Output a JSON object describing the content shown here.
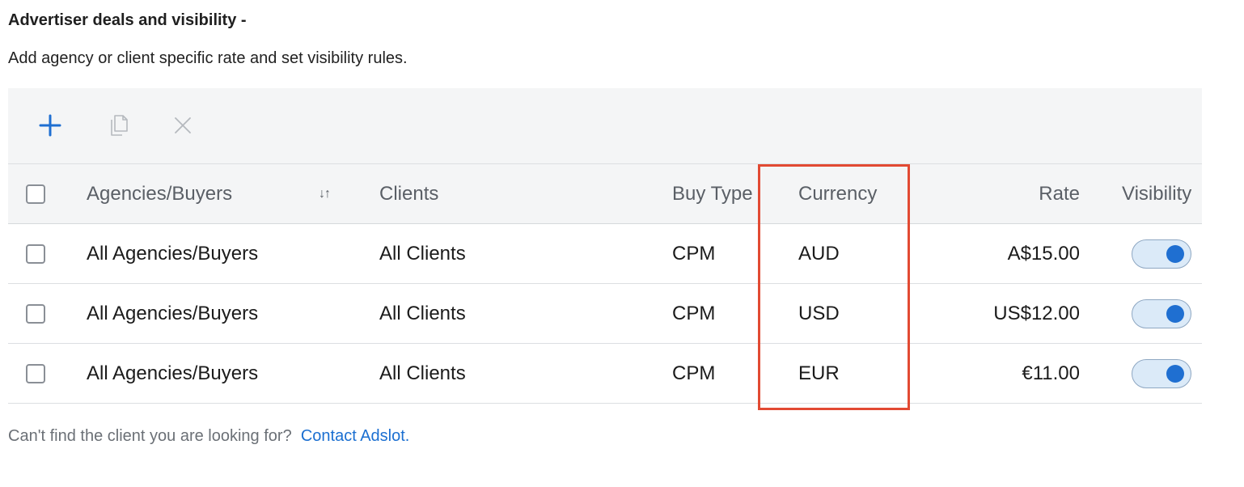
{
  "section": {
    "title": "Advertiser deals and visibility -",
    "description": "Add agency or client specific rate and set visibility rules."
  },
  "toolbar": {
    "add_icon": "plus-icon",
    "copy_icon": "copy-icon",
    "delete_icon": "close-icon",
    "add_color": "#1f6fd1",
    "disabled_color": "#b5b9be"
  },
  "table": {
    "headers": {
      "agencies": "Agencies/Buyers",
      "sort_indicator": "↓↑",
      "clients": "Clients",
      "buy_type": "Buy Type",
      "currency": "Currency",
      "rate": "Rate",
      "visibility": "Visibility"
    },
    "rows": [
      {
        "agency": "All Agencies/Buyers",
        "client": "All Clients",
        "buy_type": "CPM",
        "currency": "AUD",
        "rate": "A$15.00",
        "visible": true
      },
      {
        "agency": "All Agencies/Buyers",
        "client": "All Clients",
        "buy_type": "CPM",
        "currency": "USD",
        "rate": "US$12.00",
        "visible": true
      },
      {
        "agency": "All Agencies/Buyers",
        "client": "All Clients",
        "buy_type": "CPM",
        "currency": "EUR",
        "rate": "€11.00",
        "visible": true
      }
    ]
  },
  "annotation": {
    "highlight_color": "#e24a33",
    "highlighted_column": "Currency"
  },
  "footer": {
    "text": "Can't find the client you are looking for?",
    "link_text": "Contact Adslot."
  }
}
